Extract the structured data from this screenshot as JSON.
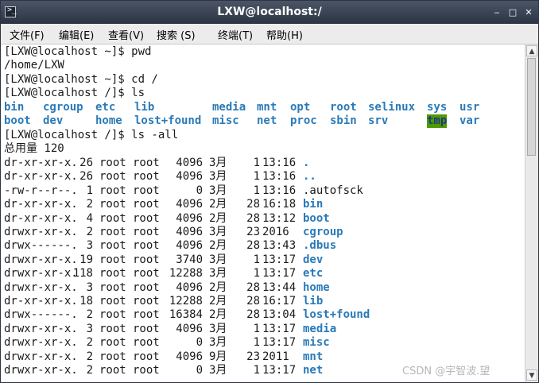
{
  "window": {
    "title": "LXW@localhost:/",
    "minimize_glyph": "‒",
    "maximize_glyph": "□",
    "close_glyph": "✕",
    "icon": "terminal-icon"
  },
  "menu": [
    "文件(F)",
    "编辑(E)",
    "查看(V)",
    "搜索 (S)",
    "终端(T)",
    "帮助(H)"
  ],
  "terminal": {
    "lines": [
      "[LXW@localhost ~]$ pwd",
      "/home/LXW",
      "[LXW@localhost ~]$ cd /",
      "[LXW@localhost /]$ ls"
    ],
    "ls_rows": [
      [
        "bin",
        "cgroup",
        "etc",
        "lib",
        "media",
        "mnt",
        "opt",
        "root",
        "selinux",
        "sys",
        "usr"
      ],
      [
        "boot",
        "dev",
        "home",
        "lost+found",
        "misc",
        "net",
        "proc",
        "sbin",
        "srv",
        "tmp",
        "var"
      ]
    ],
    "ls_all_cmd": "[LXW@localhost /]$ ls -all",
    "total": "总用量 120",
    "entries": [
      {
        "perm": "dr-xr-xr-x.",
        "links": "26",
        "owner": "root",
        "group": "root",
        "size": "4096",
        "month": "3月",
        "day": "1",
        "time": "13:16",
        "name": ".",
        "dir": true
      },
      {
        "perm": "dr-xr-xr-x.",
        "links": "26",
        "owner": "root",
        "group": "root",
        "size": "4096",
        "month": "3月",
        "day": "1",
        "time": "13:16",
        "name": "..",
        "dir": true
      },
      {
        "perm": "-rw-r--r--.",
        "links": "1",
        "owner": "root",
        "group": "root",
        "size": "0",
        "month": "3月",
        "day": "1",
        "time": "13:16",
        "name": ".autofsck",
        "dir": false
      },
      {
        "perm": "dr-xr-xr-x.",
        "links": "2",
        "owner": "root",
        "group": "root",
        "size": "4096",
        "month": "2月",
        "day": "28",
        "time": "16:18",
        "name": "bin",
        "dir": true
      },
      {
        "perm": "dr-xr-xr-x.",
        "links": "4",
        "owner": "root",
        "group": "root",
        "size": "4096",
        "month": "2月",
        "day": "28",
        "time": "13:12",
        "name": "boot",
        "dir": true
      },
      {
        "perm": "drwxr-xr-x.",
        "links": "2",
        "owner": "root",
        "group": "root",
        "size": "4096",
        "month": "3月",
        "day": "23",
        "time": "2016",
        "name": "cgroup",
        "dir": true
      },
      {
        "perm": "drwx------.",
        "links": "3",
        "owner": "root",
        "group": "root",
        "size": "4096",
        "month": "2月",
        "day": "28",
        "time": "13:43",
        "name": ".dbus",
        "dir": true
      },
      {
        "perm": "drwxr-xr-x.",
        "links": "19",
        "owner": "root",
        "group": "root",
        "size": "3740",
        "month": "3月",
        "day": "1",
        "time": "13:17",
        "name": "dev",
        "dir": true
      },
      {
        "perm": "drwxr-xr-x.",
        "links": "118",
        "owner": "root",
        "group": "root",
        "size": "12288",
        "month": "3月",
        "day": "1",
        "time": "13:17",
        "name": "etc",
        "dir": true
      },
      {
        "perm": "drwxr-xr-x.",
        "links": "3",
        "owner": "root",
        "group": "root",
        "size": "4096",
        "month": "2月",
        "day": "28",
        "time": "13:44",
        "name": "home",
        "dir": true
      },
      {
        "perm": "dr-xr-xr-x.",
        "links": "18",
        "owner": "root",
        "group": "root",
        "size": "12288",
        "month": "2月",
        "day": "28",
        "time": "16:17",
        "name": "lib",
        "dir": true
      },
      {
        "perm": "drwx------.",
        "links": "2",
        "owner": "root",
        "group": "root",
        "size": "16384",
        "month": "2月",
        "day": "28",
        "time": "13:04",
        "name": "lost+found",
        "dir": true
      },
      {
        "perm": "drwxr-xr-x.",
        "links": "3",
        "owner": "root",
        "group": "root",
        "size": "4096",
        "month": "3月",
        "day": "1",
        "time": "13:17",
        "name": "media",
        "dir": true
      },
      {
        "perm": "drwxr-xr-x.",
        "links": "2",
        "owner": "root",
        "group": "root",
        "size": "0",
        "month": "3月",
        "day": "1",
        "time": "13:17",
        "name": "misc",
        "dir": true
      },
      {
        "perm": "drwxr-xr-x.",
        "links": "2",
        "owner": "root",
        "group": "root",
        "size": "4096",
        "month": "9月",
        "day": "23",
        "time": "2011",
        "name": "mnt",
        "dir": true
      },
      {
        "perm": "drwxr-xr-x.",
        "links": "2",
        "owner": "root",
        "group": "root",
        "size": "0",
        "month": "3月",
        "day": "1",
        "time": "13:17",
        "name": "net",
        "dir": true
      }
    ]
  },
  "scrollbar": {
    "up_glyph": "▲",
    "down_glyph": "▼"
  },
  "watermark": "CSDN @宇智波.望",
  "colors": {
    "dir": "#2a7ab8",
    "tmp_highlight": "#4e9a06",
    "titlebar": "#2b3443"
  }
}
